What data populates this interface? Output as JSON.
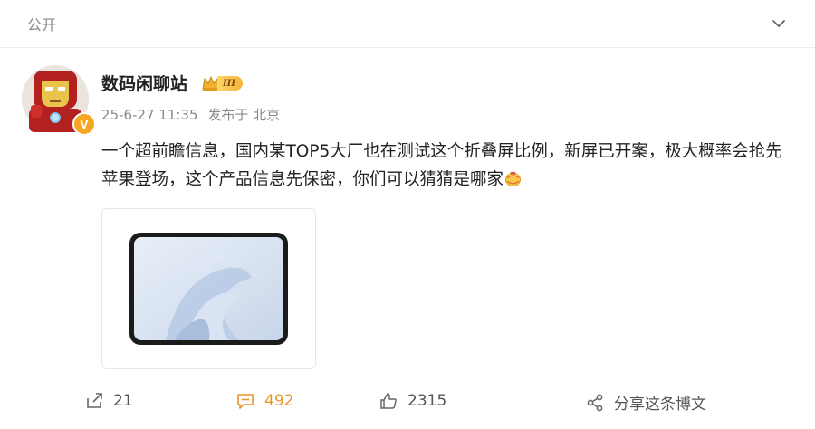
{
  "header": {
    "visibility_label": "公开",
    "collapse_icon": "chevron-down-icon"
  },
  "post": {
    "author": {
      "name": "数码闲聊站",
      "level_badge": "III",
      "verified_mark": "V",
      "avatar_icon": "iron-man-avatar",
      "verified_color": "#f5a623"
    },
    "time": "25-6-27 11:35",
    "source": "发布于 北京",
    "text": "一个超前瞻信息，国内某TOP5大厂也在测试这个折叠屏比例，新屏已开案，极大概率会抢先苹果登场，这个产品信息先保密，你们可以猜猜是哪家",
    "emoji_icon": "lantern-emoji-icon",
    "image_icon": "foldable-tablet-image"
  },
  "actions": {
    "repost": {
      "icon": "share-arrow-icon",
      "count": "21"
    },
    "comment": {
      "icon": "comment-icon",
      "count": "492",
      "color": "#e8962d"
    },
    "like": {
      "icon": "thumbs-up-icon",
      "count": "2315"
    },
    "share": {
      "icon": "share-nodes-icon",
      "label": "分享这条博文"
    }
  }
}
